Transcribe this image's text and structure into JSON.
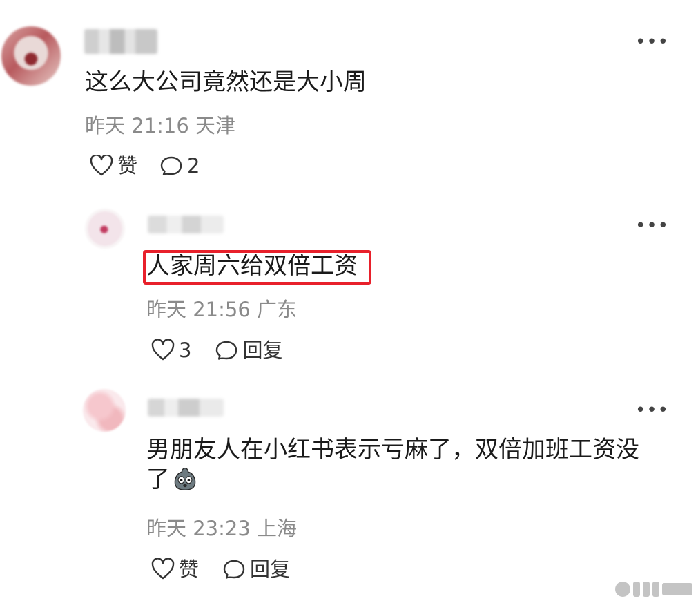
{
  "comments": [
    {
      "text": "这么大公司竟然还是大小周",
      "time": "昨天 21:16",
      "location": "天津",
      "like_label": "赞",
      "reply_count": "2",
      "more_icon": "more-icon"
    },
    {
      "text": "人家周六给双倍工资",
      "time": "昨天 21:56",
      "location": "广东",
      "like_count": "3",
      "reply_label": "回复",
      "highlight_color": "#e8202b"
    },
    {
      "text_line1": "男朋友人在小红书表示亏麻了，双倍加班工资没",
      "text_line2": "了",
      "emoji": "shocked-face-emoji",
      "time": "昨天 23:23",
      "location": "上海",
      "like_label": "赞",
      "reply_label": "回复"
    }
  ]
}
